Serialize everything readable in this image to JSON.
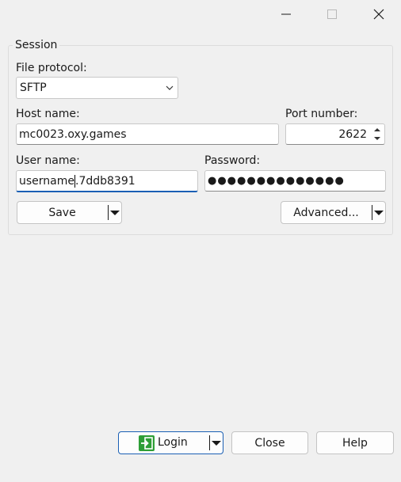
{
  "window": {
    "controls": {
      "minimize": "minimize",
      "maximize": "maximize",
      "close": "close"
    }
  },
  "session": {
    "legend": "Session",
    "file_protocol": {
      "label": "File protocol:",
      "value": "SFTP"
    },
    "host": {
      "label": "Host name:",
      "value": "mc0023.oxy.games"
    },
    "port": {
      "label": "Port number:",
      "value": "2622"
    },
    "user": {
      "label": "User name:",
      "value_before_caret": "username",
      "value_after_caret": ".7ddb8391"
    },
    "password": {
      "label": "Password:",
      "masked": "●●●●●●●●●●●●●●"
    },
    "save_label": "Save",
    "advanced_label": "Advanced..."
  },
  "footer": {
    "login_label": "Login",
    "close_label": "Close",
    "help_label": "Help"
  },
  "colors": {
    "focus": "#1a5fb4",
    "login_icon_bg": "#2e9e36",
    "background": "#f0f0f0"
  },
  "icons": {
    "login": "login-icon",
    "minimize": "minimize-icon",
    "maximize": "maximize-icon",
    "close": "close-icon"
  }
}
